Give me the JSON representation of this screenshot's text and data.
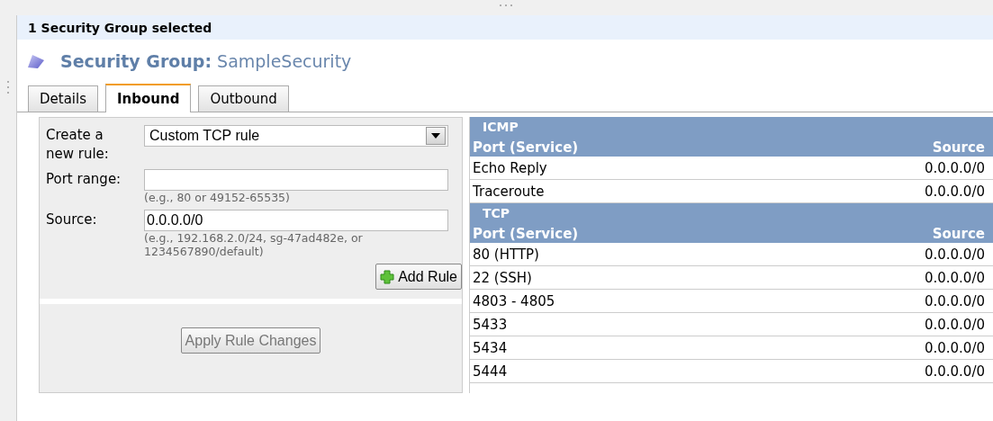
{
  "selection_bar": {
    "text": "1 Security Group selected"
  },
  "title": {
    "label": "Security Group:",
    "name": "SampleSecurity"
  },
  "tabs": [
    {
      "label": "Details",
      "selected": false
    },
    {
      "label": "Inbound",
      "selected": true
    },
    {
      "label": "Outbound",
      "selected": false
    }
  ],
  "rule_form": {
    "rule_type": {
      "label": "Create a new rule:",
      "value": "Custom TCP rule"
    },
    "port_range": {
      "label": "Port range:",
      "hint": "(e.g., 80 or 49152-65535)"
    },
    "source": {
      "label": "Source:",
      "value": "0.0.0.0/0",
      "hint": "(e.g., 192.168.2.0/24, sg-47ad482e, or 1234567890/default)"
    },
    "add_button": "Add Rule",
    "apply_button": {
      "label": "Apply Rule Changes",
      "disabled": true
    }
  },
  "rule_groups": [
    {
      "protocol": "ICMP",
      "columns": [
        "Port (Service)",
        "Source"
      ],
      "rows": [
        [
          "Echo Reply",
          "0.0.0.0/0"
        ],
        [
          "Traceroute",
          "0.0.0.0/0"
        ]
      ]
    },
    {
      "protocol": "TCP",
      "columns": [
        "Port (Service)",
        "Source"
      ],
      "rows": [
        [
          "80 (HTTP)",
          "0.0.0.0/0"
        ],
        [
          "22 (SSH)",
          "0.0.0.0/0"
        ],
        [
          "4803 - 4805",
          "0.0.0.0/0"
        ],
        [
          "5433",
          "0.0.0.0/0"
        ],
        [
          "5434",
          "0.0.0.0/0"
        ],
        [
          "5444",
          "0.0.0.0/0"
        ]
      ]
    }
  ]
}
